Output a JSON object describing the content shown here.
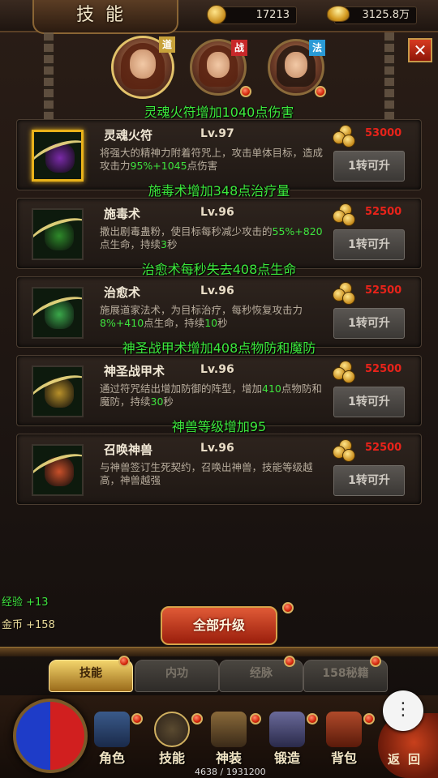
{
  "header": {
    "title": "技能",
    "gold_amount": "17213",
    "ingot_amount": "3125.8万"
  },
  "characters": [
    {
      "class_tag": "道",
      "tag_color": "#c8a23a",
      "selected": true
    },
    {
      "class_tag": "战",
      "tag_color": "#c8282a",
      "selected": false
    },
    {
      "class_tag": "法",
      "tag_color": "#2a9ad6",
      "selected": false
    }
  ],
  "close_label": "✕",
  "messages": {
    "m1": "灵魂火符增加1040点伤害",
    "m2": "施毒术增加348点治疗量",
    "m3": "治愈术每秒失去408点生命",
    "m4": "神圣战甲术增加408点物防和魔防",
    "m5": "神兽等级增加95"
  },
  "skills": [
    {
      "name": "灵魂火符",
      "level": "Lv.97",
      "desc_a": "将强大的精神力附着符咒上，攻击单体目标，造成攻击力",
      "desc_hl": "95%+1045",
      "desc_b": "点伤害",
      "cost": "53000",
      "button": "1转可升",
      "icon_color": "#7a2aa8"
    },
    {
      "name": "施毒术",
      "level": "Lv.96",
      "desc_a": "撒出剧毒蛊粉，使目标每秒减少攻击的",
      "desc_hl": "55%+820",
      "desc_b": "点生命，持续",
      "desc_hl2": "3",
      "desc_c": "秒",
      "cost": "52500",
      "button": "1转可升",
      "icon_color": "#2e8a2a"
    },
    {
      "name": "治愈术",
      "level": "Lv.96",
      "desc_a": "施展道家法术，为目标治疗，每秒恢复攻击力",
      "desc_hl": "8%+410",
      "desc_b": "点生命，持续",
      "desc_hl2": "10",
      "desc_c": "秒",
      "cost": "52500",
      "button": "1转可升",
      "icon_color": "#3aa84a"
    },
    {
      "name": "神圣战甲术",
      "level": "Lv.96",
      "desc_a": "通过符咒结出增加防御的阵型，增加",
      "desc_hl": "410",
      "desc_b": "点物防和魔防，持续",
      "desc_hl2": "30",
      "desc_c": "秒",
      "cost": "52500",
      "button": "1转可升",
      "icon_color": "#b8902a"
    },
    {
      "name": "召唤神兽",
      "level": "Lv.96",
      "desc_a": "与神兽签订生死契约，召唤出神兽，技能等级越高，神兽越强",
      "cost": "52500",
      "button": "1转可升",
      "icon_color": "#c8502a"
    }
  ],
  "log": {
    "exp": "经验 +13",
    "gold": "金币  +158"
  },
  "upgrade_all_label": "全部升级",
  "tabs": [
    "技能",
    "内功",
    "经脉",
    "158秘籍"
  ],
  "nav": [
    "角色",
    "技能",
    "神装",
    "锻造",
    "背包"
  ],
  "back_label": "返回",
  "exp_progress": "4638 / 1931200",
  "more_label": "⋮"
}
